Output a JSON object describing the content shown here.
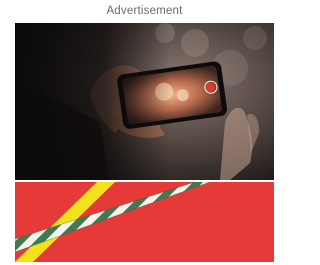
{
  "ad": {
    "label": "Advertisement"
  },
  "icons": {
    "photo": "video-recording-photo",
    "banner": "caution-tape-banner"
  },
  "colors": {
    "label_text": "#6b6b6b",
    "banner_red": "#e53a37",
    "tape_yellow": "#f2e21b",
    "tape_green": "#3f7a52",
    "tape_white": "#f4f4ee"
  }
}
